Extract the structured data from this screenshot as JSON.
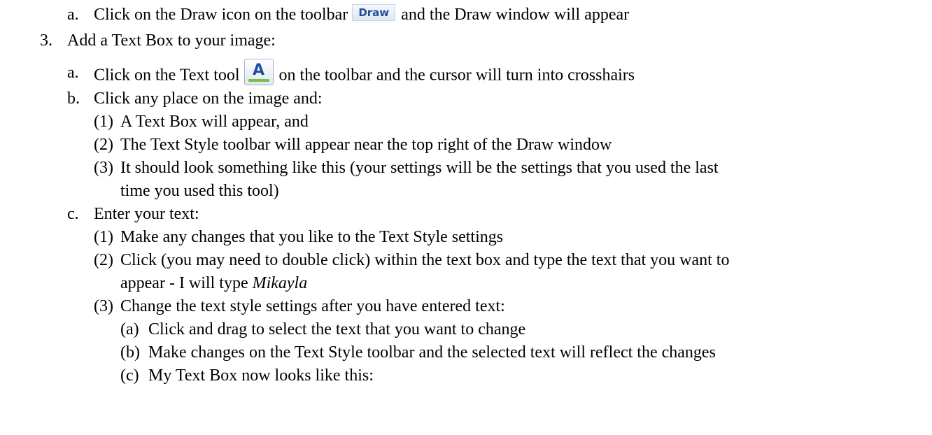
{
  "lines": {
    "l1": {
      "marker": "a.",
      "before": "Click on the Draw icon on the toolbar",
      "icon_label": "Draw",
      "after": "and the Draw window will appear"
    },
    "l2": {
      "marker": "3.",
      "text": "Add a Text Box to your image:"
    },
    "l3": {
      "marker": "a.",
      "before": "Click on the Text tool",
      "icon_glyph": "A",
      "after": "on the toolbar and the cursor will turn into crosshairs"
    },
    "l4": {
      "marker": "b.",
      "text": "Click any place on the image and:"
    },
    "l5": {
      "marker": "(1)",
      "text": "A Text Box will appear, and"
    },
    "l6": {
      "marker": "(2)",
      "text": "The Text Style toolbar will appear near the top right of the Draw window"
    },
    "l7": {
      "marker": "(3)",
      "text": "It should look something like this (your settings will be the settings that you used the last"
    },
    "l8": {
      "text": "time you used this tool)"
    },
    "l9": {
      "marker": "c.",
      "text": "Enter your text:"
    },
    "l10": {
      "marker": "(1)",
      "text": "Make any changes that you like to the Text Style settings"
    },
    "l11": {
      "marker": "(2)",
      "text": "Click (you may need to double click) within the text box and type the text that you want to"
    },
    "l12": {
      "before": "appear - I will type",
      "emphasis": "Mikayla"
    },
    "l13": {
      "marker": "(3)",
      "text": "Change the text style settings after you have entered text:"
    },
    "l14": {
      "marker": "(a)",
      "text": "Click and drag to select the text that you want to change"
    },
    "l15": {
      "marker": "(b)",
      "text": "Make changes on the Text Style toolbar and the selected text will reflect the changes"
    },
    "l16": {
      "marker": "(c)",
      "text": "My Text Box now looks like this:"
    }
  },
  "icons": {
    "draw_icon": "draw-toolbar-icon",
    "text_tool_icon": "text-tool-icon",
    "draw_icon_text_color": "#1f4e96",
    "text_tool_glyph_color": "#1d4f9a"
  }
}
